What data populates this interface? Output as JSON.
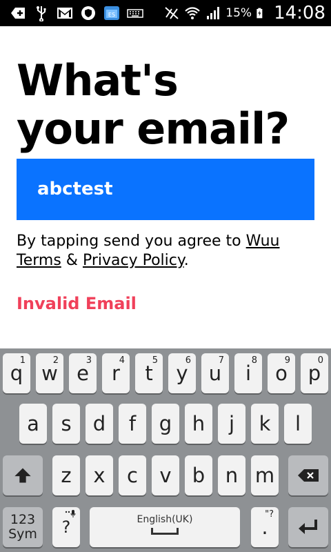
{
  "status_bar": {
    "battery_percent": "15%",
    "time": "14:08",
    "icons": [
      "add-icon",
      "usb-icon",
      "gmail-icon",
      "vpn-shield-icon",
      "es-file-icon",
      "keyboard-icon",
      "mute-icon",
      "wifi-icon",
      "signal-icon",
      "battery-icon"
    ]
  },
  "title": {
    "line1": "What's",
    "line2": "your email?"
  },
  "email_field": {
    "value": "abctest"
  },
  "terms": {
    "prefix": "By tapping send you agree to",
    "link1": "Wuu Terms",
    "ampersand": "&",
    "link2": "Privacy Policy",
    "suffix": "."
  },
  "error_text": "Invalid Email",
  "keyboard": {
    "row1": [
      {
        "key": "q",
        "sup": "1"
      },
      {
        "key": "w",
        "sup": "2"
      },
      {
        "key": "e",
        "sup": "3"
      },
      {
        "key": "r",
        "sup": "4"
      },
      {
        "key": "t",
        "sup": "5"
      },
      {
        "key": "y",
        "sup": "6"
      },
      {
        "key": "u",
        "sup": "7"
      },
      {
        "key": "i",
        "sup": "8"
      },
      {
        "key": "o",
        "sup": "9"
      },
      {
        "key": "p",
        "sup": "0"
      }
    ],
    "row2": [
      "a",
      "s",
      "d",
      "f",
      "g",
      "h",
      "j",
      "k",
      "l"
    ],
    "row3": [
      "z",
      "x",
      "c",
      "v",
      "b",
      "n",
      "m"
    ],
    "sym_label_line1": "123",
    "sym_label_line2": "Sym",
    "question_key": "?",
    "space_language": "English(UK)",
    "period_key": ".",
    "period_sup": "\"?"
  }
}
